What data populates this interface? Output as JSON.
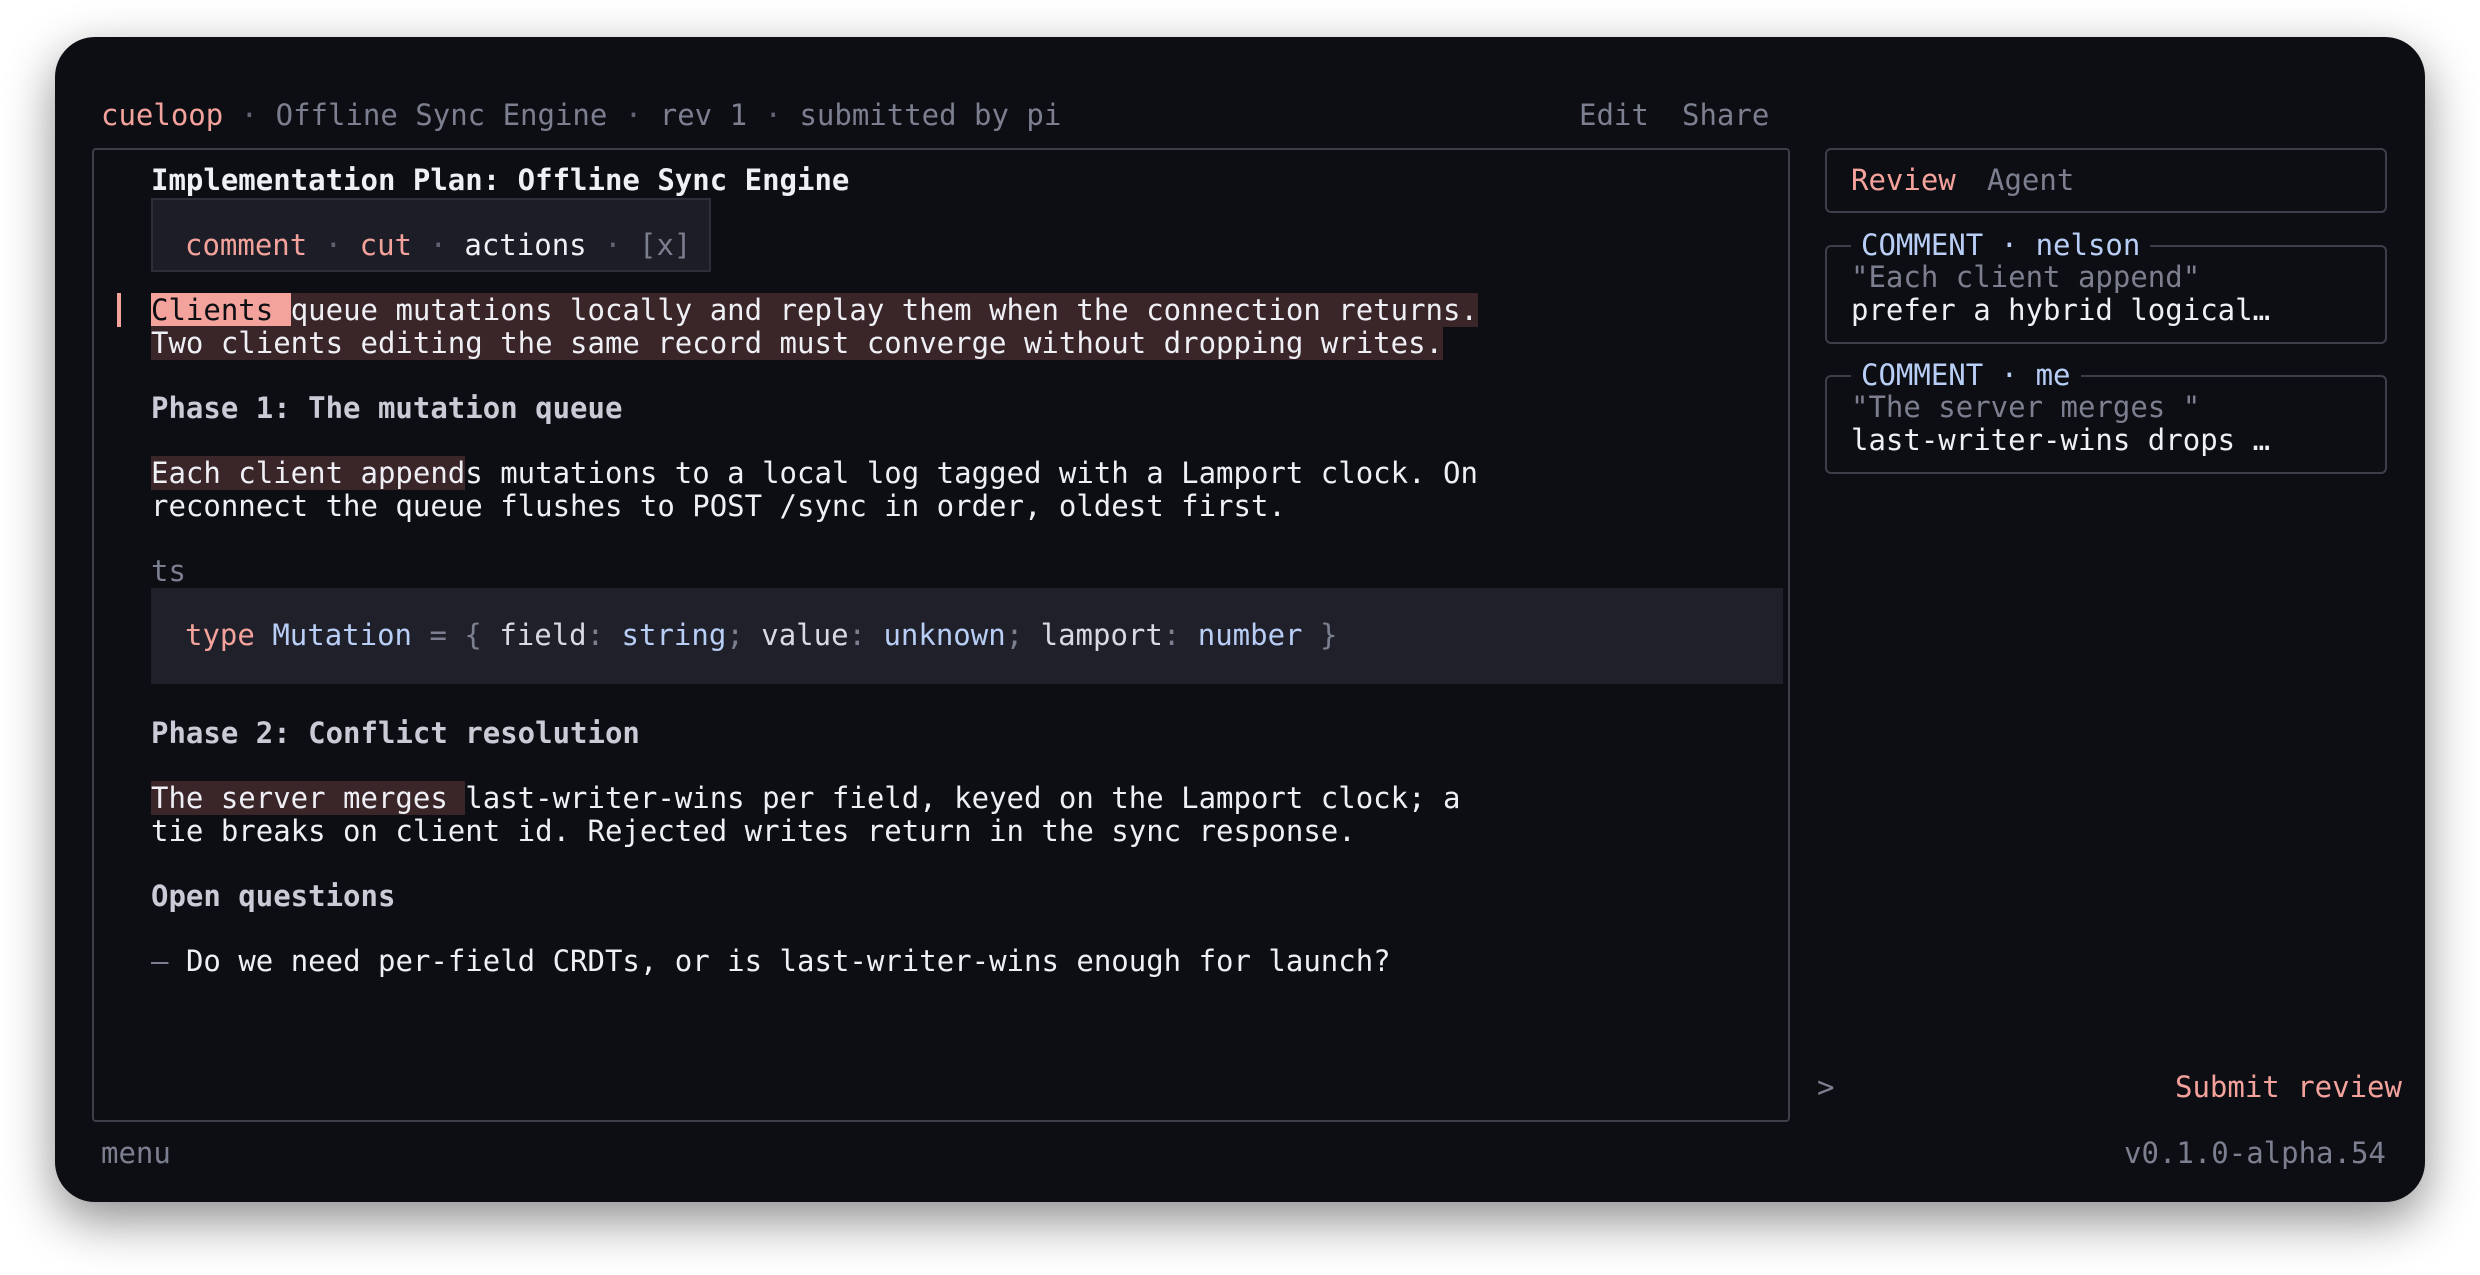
{
  "header": {
    "app": "cueloop",
    "sep": " · ",
    "doc_title": "Offline Sync Engine",
    "rev": "rev 1",
    "submitted": "submitted by pi",
    "edit": "Edit",
    "share": "Share"
  },
  "doc": {
    "title": "Implementation Plan: Offline Sync Engine",
    "actionbar": {
      "comment": "comment",
      "cut": "cut",
      "actions": "actions",
      "close": "[x]",
      "sep": " · "
    },
    "intro": {
      "selected": "Clients ",
      "line1_rest": "queue mutations locally and replay them when the connection returns.",
      "line2": "Two clients editing the same record must converge without dropping writes."
    },
    "phase1": {
      "heading": "Phase 1: The mutation queue",
      "highlight": "Each client append",
      "line1_rest": "s mutations to a local log tagged with a Lamport clock. On",
      "line2": "reconnect the queue flushes to POST /sync in order, oldest first."
    },
    "code": {
      "lang": "ts",
      "kw": "type",
      "name": "Mutation",
      "eq": " = { ",
      "f1": "field",
      "t1": "string",
      "f2": "value",
      "t2": "unknown",
      "f3": "lamport",
      "t3": "number",
      "colon": ": ",
      "semi": "; ",
      "close": " }"
    },
    "phase2": {
      "heading": "Phase 2: Conflict resolution",
      "highlight": "The server merges ",
      "line1_rest": "last-writer-wins per field, keyed on the Lamport clock; a",
      "line2": "tie breaks on client id. Rejected writes return in the sync response."
    },
    "open": {
      "heading": "Open questions",
      "dash": "–",
      "item": "Do we need per-field CRDTs, or is last-writer-wins enough for launch?"
    }
  },
  "sidebar": {
    "tabs": {
      "review": "Review",
      "agent": "Agent"
    },
    "comments": [
      {
        "title": "COMMENT · nelson",
        "quote": "\"Each client append\"",
        "body": "prefer a hybrid logical…"
      },
      {
        "title": "COMMENT · me",
        "quote": "\"The server merges \"",
        "body": "last-writer-wins drops …"
      }
    ],
    "prompt": ">",
    "submit": "Submit review"
  },
  "footer": {
    "menu": "menu",
    "version": "v0.1.0-alpha.54"
  },
  "colors": {
    "accent": "#f4a29c",
    "blue": "#b8cef6",
    "bg": "#0d0e13"
  }
}
